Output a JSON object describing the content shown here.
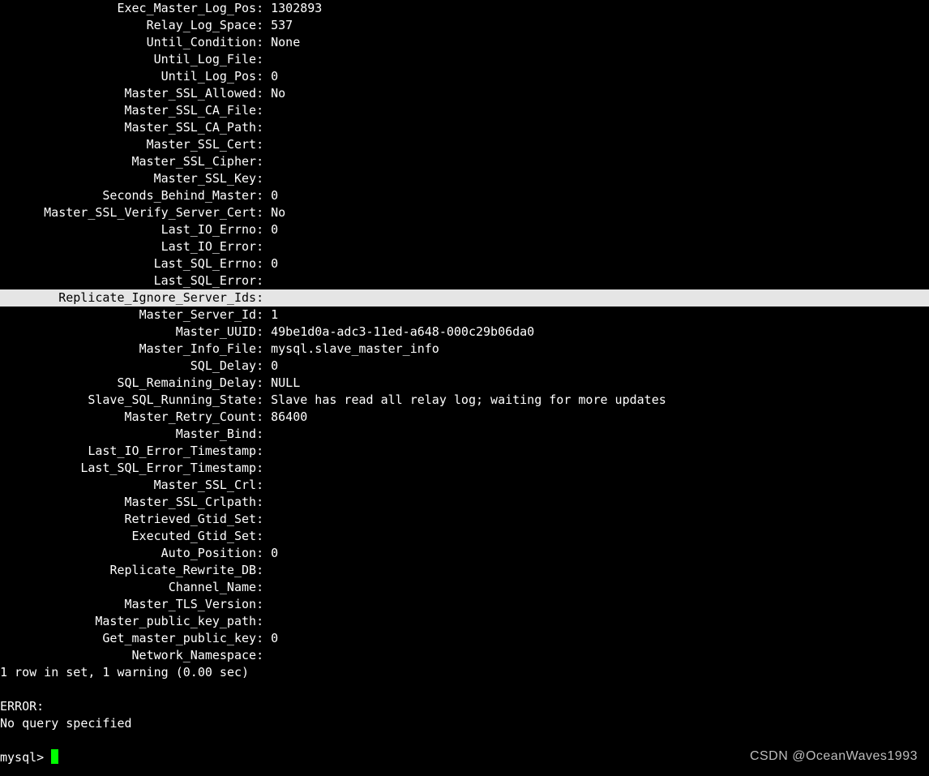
{
  "status": [
    {
      "k": "Exec_Master_Log_Pos",
      "v": "1302893",
      "hl": false
    },
    {
      "k": "Relay_Log_Space",
      "v": "537",
      "hl": false
    },
    {
      "k": "Until_Condition",
      "v": "None",
      "hl": false
    },
    {
      "k": "Until_Log_File",
      "v": "",
      "hl": false
    },
    {
      "k": "Until_Log_Pos",
      "v": "0",
      "hl": false
    },
    {
      "k": "Master_SSL_Allowed",
      "v": "No",
      "hl": false
    },
    {
      "k": "Master_SSL_CA_File",
      "v": "",
      "hl": false
    },
    {
      "k": "Master_SSL_CA_Path",
      "v": "",
      "hl": false
    },
    {
      "k": "Master_SSL_Cert",
      "v": "",
      "hl": false
    },
    {
      "k": "Master_SSL_Cipher",
      "v": "",
      "hl": false
    },
    {
      "k": "Master_SSL_Key",
      "v": "",
      "hl": false
    },
    {
      "k": "Seconds_Behind_Master",
      "v": "0",
      "hl": false
    },
    {
      "k": "Master_SSL_Verify_Server_Cert",
      "v": "No",
      "hl": false
    },
    {
      "k": "Last_IO_Errno",
      "v": "0",
      "hl": false
    },
    {
      "k": "Last_IO_Error",
      "v": "",
      "hl": false
    },
    {
      "k": "Last_SQL_Errno",
      "v": "0",
      "hl": false
    },
    {
      "k": "Last_SQL_Error",
      "v": "",
      "hl": false
    },
    {
      "k": "Replicate_Ignore_Server_Ids",
      "v": "",
      "hl": true
    },
    {
      "k": "Master_Server_Id",
      "v": "1",
      "hl": false
    },
    {
      "k": "Master_UUID",
      "v": "49be1d0a-adc3-11ed-a648-000c29b06da0",
      "hl": false
    },
    {
      "k": "Master_Info_File",
      "v": "mysql.slave_master_info",
      "hl": false
    },
    {
      "k": "SQL_Delay",
      "v": "0",
      "hl": false
    },
    {
      "k": "SQL_Remaining_Delay",
      "v": "NULL",
      "hl": false
    },
    {
      "k": "Slave_SQL_Running_State",
      "v": "Slave has read all relay log; waiting for more updates",
      "hl": false
    },
    {
      "k": "Master_Retry_Count",
      "v": "86400",
      "hl": false
    },
    {
      "k": "Master_Bind",
      "v": "",
      "hl": false
    },
    {
      "k": "Last_IO_Error_Timestamp",
      "v": "",
      "hl": false
    },
    {
      "k": "Last_SQL_Error_Timestamp",
      "v": "",
      "hl": false
    },
    {
      "k": "Master_SSL_Crl",
      "v": "",
      "hl": false
    },
    {
      "k": "Master_SSL_Crlpath",
      "v": "",
      "hl": false
    },
    {
      "k": "Retrieved_Gtid_Set",
      "v": "",
      "hl": false
    },
    {
      "k": "Executed_Gtid_Set",
      "v": "",
      "hl": false
    },
    {
      "k": "Auto_Position",
      "v": "0",
      "hl": false
    },
    {
      "k": "Replicate_Rewrite_DB",
      "v": "",
      "hl": false
    },
    {
      "k": "Channel_Name",
      "v": "",
      "hl": false
    },
    {
      "k": "Master_TLS_Version",
      "v": "",
      "hl": false
    },
    {
      "k": "Master_public_key_path",
      "v": "",
      "hl": false
    },
    {
      "k": "Get_master_public_key",
      "v": "0",
      "hl": false
    },
    {
      "k": "Network_Namespace",
      "v": "",
      "hl": false
    }
  ],
  "footer": {
    "summary": "1 row in set, 1 warning (0.00 sec)",
    "blank1": "",
    "error_label": "ERROR:",
    "error_msg": "No query specified",
    "blank2": "",
    "prompt": "mysql> "
  },
  "watermark": "CSDN @OceanWaves1993"
}
